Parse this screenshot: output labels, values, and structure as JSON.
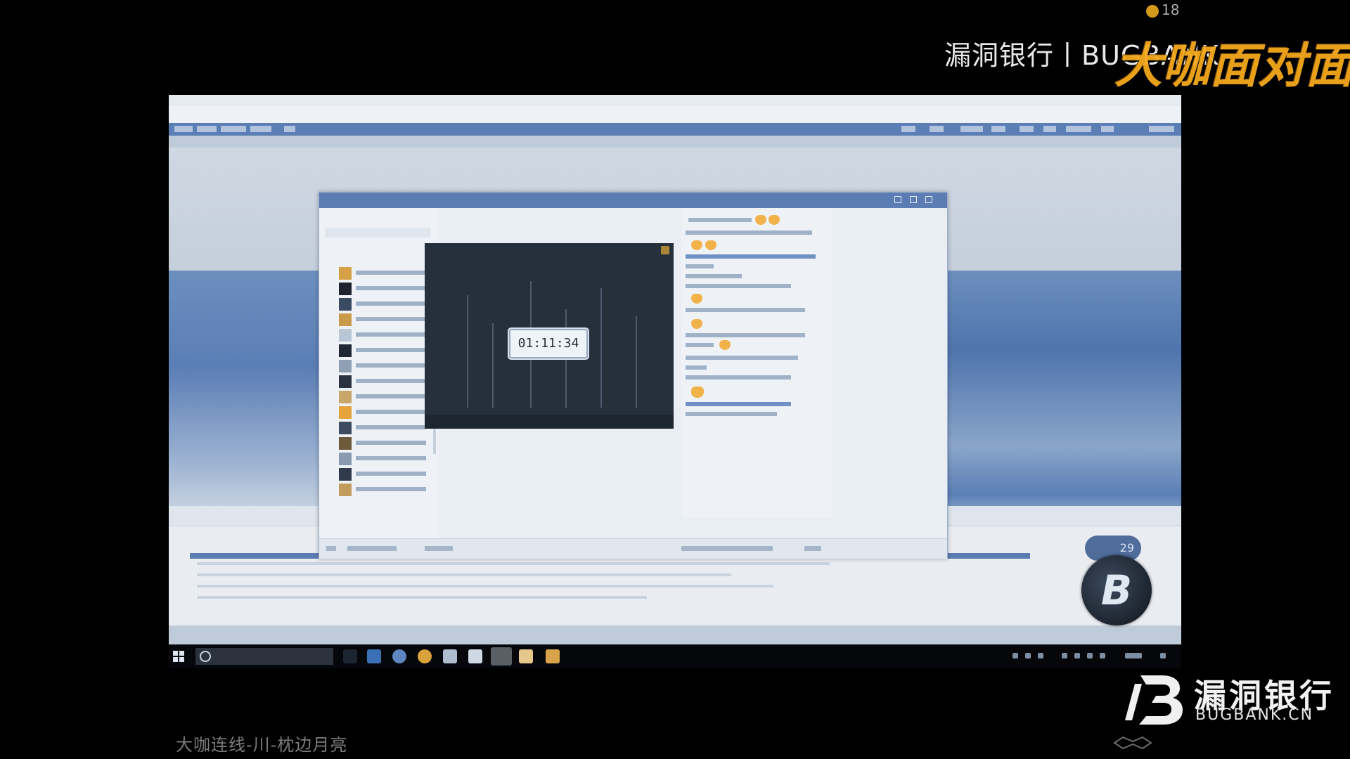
{
  "overlay": {
    "top_logo_text": "漏洞银行丨BUGBANK",
    "top_counter": "18",
    "brand_logo": "大咖面对面",
    "caption": "大咖连线-川-枕边月亮",
    "bugbank_name": "漏洞银行",
    "bugbank_url": "BUGBANK.CN",
    "b3_avatar": "B",
    "pill_badge": "29"
  },
  "timer": {
    "value": "01:11:34"
  },
  "colors": {
    "accent_orange": "#f5a81c",
    "window_blue": "#5b7db3",
    "taskbar": "#05070a"
  },
  "icons": {
    "start": "windows-start-icon",
    "search": "search-icon",
    "taskbar_apps": [
      "task-view-icon",
      "edge-icon",
      "browser-icon",
      "chrome-icon",
      "mail-icon",
      "store-icon",
      "qq-icon",
      "notes-icon",
      "folder-icon"
    ]
  }
}
